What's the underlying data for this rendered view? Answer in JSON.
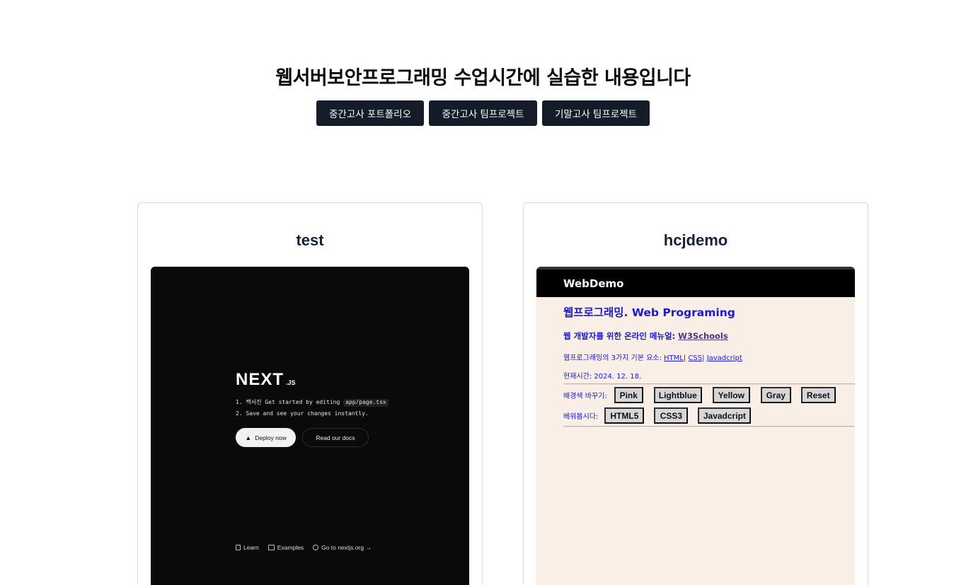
{
  "header": {
    "title": "웹서버보안프로그래밍 수업시간에 실습한 내용입니다"
  },
  "tabs": [
    {
      "label": "중간고사 포트폴리오"
    },
    {
      "label": "중간고사 팀프로젝트"
    },
    {
      "label": "기말고사 팀프로젝트"
    }
  ],
  "cards": [
    {
      "title": "test",
      "preview": {
        "logo": "NEXT",
        "logo_suffix": ".JS",
        "step1_prefix": "1. 백서진 Get started by editing ",
        "step1_code": "app/page.tsx",
        "step2": "2. Save and see your changes instantly.",
        "deploy_label": "Deploy now",
        "docs_label": "Read our docs",
        "footer": [
          "Learn",
          "Examples",
          "Go to nextjs.org →"
        ]
      }
    },
    {
      "title": "hcjdemo",
      "preview": {
        "header": "WebDemo",
        "heading": "웹프로그래밍. Web Programing",
        "menu_prefix": "웹 개발자를 위한 온라인 메뉴얼: ",
        "menu_link": "W3Schools",
        "elements_prefix": "웹프로그래밍의 3가지 기본 요소: ",
        "elements_links": [
          "HTML",
          "CSS",
          "Javadcript"
        ],
        "time_text": "현재시간: 2024. 12. 18.",
        "bg_label": "배경색 바꾸기:",
        "bg_buttons": [
          "Pink",
          "Lightblue",
          "Yellow",
          "Gray",
          "Reset"
        ],
        "learn_label": "베워봅시다:",
        "learn_buttons": [
          "HTML5",
          "CSS3",
          "Javadcript"
        ]
      }
    }
  ]
}
